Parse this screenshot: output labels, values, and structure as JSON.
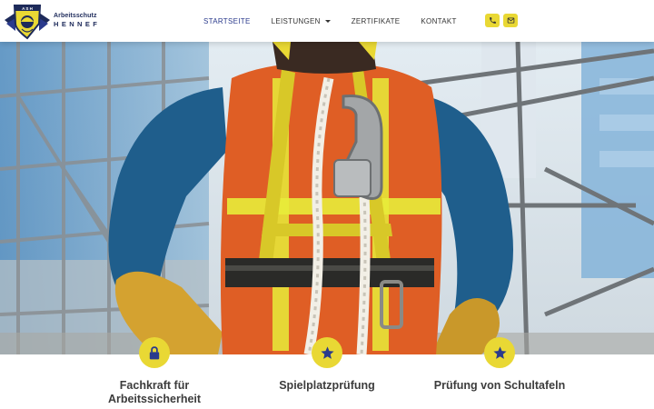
{
  "brand": {
    "line1": "Arbeitsschutz",
    "line2": "HENNEF",
    "crest_letters": "A S H"
  },
  "nav": {
    "items": [
      {
        "label": "STARTSEITE",
        "active": true
      },
      {
        "label": "LEISTUNGEN",
        "active": false,
        "dropdown": true
      },
      {
        "label": "ZERTIFIKATE",
        "active": false
      },
      {
        "label": "KONTAKT",
        "active": false
      }
    ]
  },
  "contact": {
    "phone_icon": "phone-icon",
    "email_icon": "email-icon"
  },
  "hero": {
    "image": "worker-in-safety-harness-on-scaffolding"
  },
  "features": [
    {
      "title": "Fachkraft für Arbeitssicherheit",
      "icon": "lock-icon"
    },
    {
      "title": "Spielplatzprüfung",
      "icon": "star-icon"
    },
    {
      "title": "Prüfung von Schultafeln",
      "icon": "star-icon"
    }
  ],
  "colors": {
    "accent": "#e9d834",
    "brand_navy": "#1d2a5a",
    "nav_active": "#2a3a8c",
    "vest_orange": "#e8642a",
    "jacket_blue": "#1f5e8c"
  }
}
